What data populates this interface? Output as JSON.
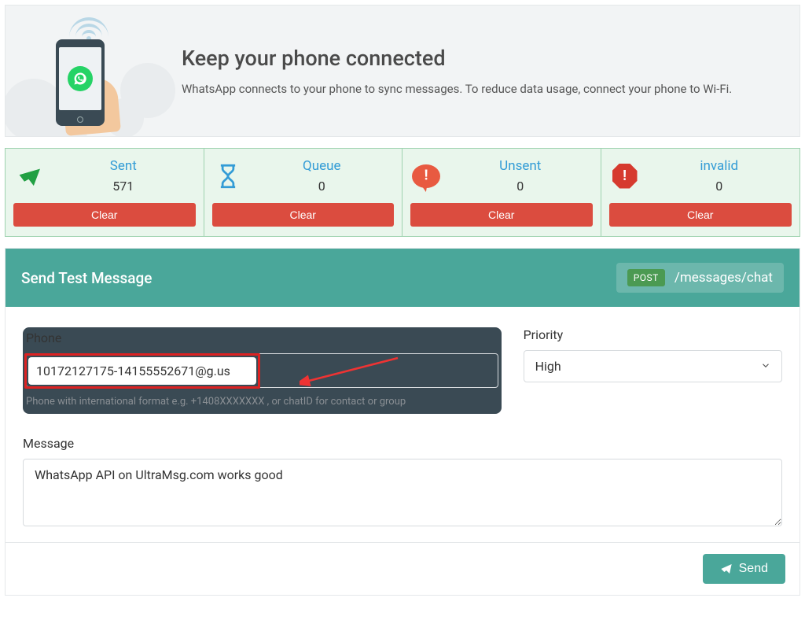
{
  "banner": {
    "title": "Keep your phone connected",
    "subtitle": "WhatsApp connects to your phone to sync messages. To reduce data usage, connect your phone to Wi-Fi."
  },
  "stats": [
    {
      "title": "Sent",
      "value": "571",
      "clear": "Clear"
    },
    {
      "title": "Queue",
      "value": "0",
      "clear": "Clear"
    },
    {
      "title": "Unsent",
      "value": "0",
      "clear": "Clear"
    },
    {
      "title": "invalid",
      "value": "0",
      "clear": "Clear"
    }
  ],
  "panel": {
    "title": "Send Test Message",
    "method": "POST",
    "endpoint": "/messages/chat",
    "phone_label": "Phone",
    "phone_value": "10172127175-14155552671@g.us",
    "phone_hint": "Phone with international format e.g. +1408XXXXXXX , or chatID for contact or group",
    "priority_label": "Priority",
    "priority_value": "High",
    "message_label": "Message",
    "message_value": "WhatsApp API on UltraMsg.com works good",
    "send_label": "Send"
  }
}
